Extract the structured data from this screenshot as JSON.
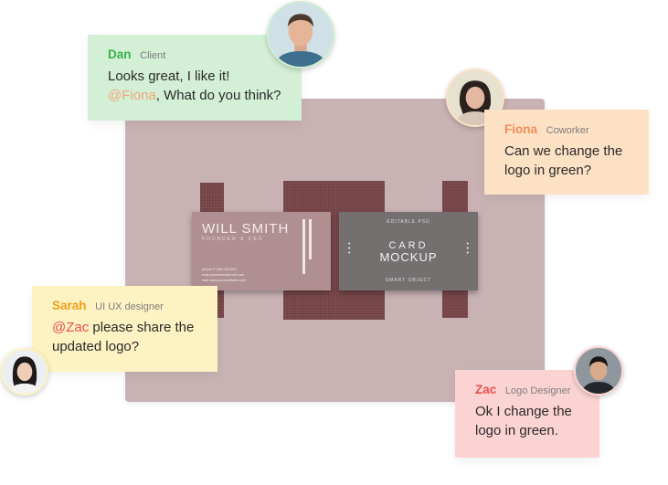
{
  "mockup": {
    "left_card": {
      "name": "WILL SMITH",
      "role": "FOUNDER & CEO",
      "contact_lines": [
        "phone 0 000 000 000",
        "mail yourname@mail.com",
        "web www.yourwebsite.com"
      ]
    },
    "right_card": {
      "top": "EDITABLE PSD",
      "title_line1": "CARD",
      "title_line2": "MOCKUP",
      "bottom": "SMART OBJECT"
    }
  },
  "comments": {
    "dan": {
      "name": "Dan",
      "role": "Client",
      "line1": "Looks great, I like it!",
      "mention": "@Fiona",
      "line2_rest": ", What do you think?",
      "mention_color": "#f2a57a"
    },
    "fiona": {
      "name": "Fiona",
      "role": "Coworker",
      "message": "Can we change the logo in green?"
    },
    "sarah": {
      "name": "Sarah",
      "role": "UI UX designer",
      "mention": "@Zac",
      "line1_rest": " please share the",
      "line2": "updated logo?",
      "mention_color": "#ee4e4e"
    },
    "zac": {
      "name": "Zac",
      "role": "Logo Designer",
      "message": "Ok I change the logo in green."
    }
  },
  "colors": {
    "dan_bg": "#d3efd5",
    "fiona_bg": "#fde1c5",
    "sarah_bg": "#fdf2c2",
    "zac_bg": "#fcd3d3"
  }
}
